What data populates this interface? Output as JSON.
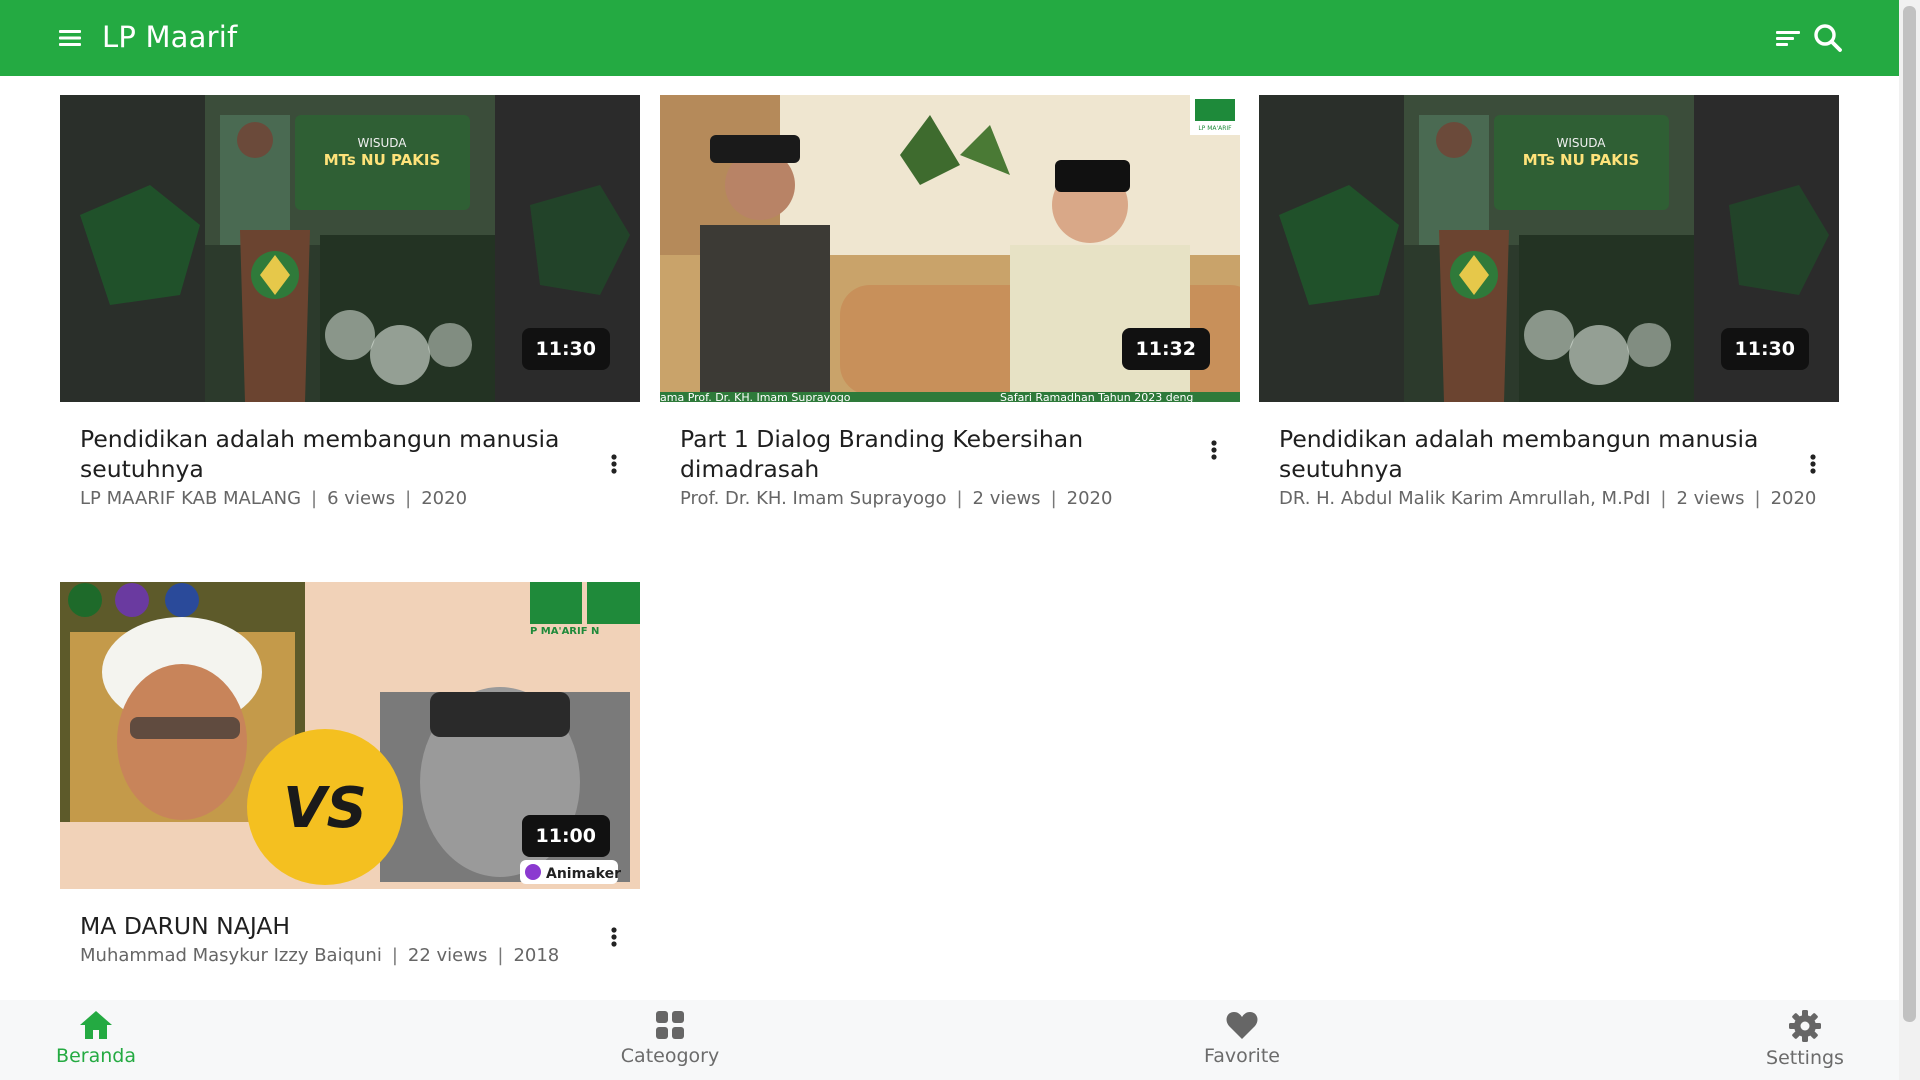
{
  "app": {
    "title": "LP Maarif",
    "accent_color": "#24aa42"
  },
  "videos": [
    {
      "title": "Pendidikan adalah membangun manusia seutuhnya",
      "channel": "LP MAARIF KAB MALANG",
      "views": "6 views",
      "year": "2020",
      "duration": "11:30",
      "thumbnail_text": [
        "WISUDA",
        "MTs NU PAKIS"
      ]
    },
    {
      "title": "Part 1 Dialog Branding Kebersihan dimadrasah",
      "channel": "Prof. Dr. KH. Imam Suprayogo",
      "views": "2 views",
      "year": "2020",
      "duration": "11:32",
      "thumbnail_text": [
        "ama Prof. Dr. KH. Imam Suprayogo",
        "Safari Ramadhan Tahun 2023 deng",
        "LP MA'ARIF"
      ]
    },
    {
      "title": "Pendidikan adalah membangun manusia seutuhnya",
      "channel": "DR. H. Abdul Malik Karim Amrullah, M.PdI",
      "views": "2 views",
      "year": "2020",
      "duration": "11:30",
      "thumbnail_text": [
        "WISUDA",
        "MTs NU PAKIS"
      ]
    },
    {
      "title": "MA DARUN NAJAH",
      "channel": "Muhammad Masykur Izzy Baiquni",
      "views": "22 views",
      "year": "2018",
      "duration": "11:00",
      "thumbnail_text": [
        "VS",
        "Animaker",
        "P MA'ARIF N"
      ]
    }
  ],
  "bottom_nav": [
    {
      "label": "Beranda",
      "icon": "home-icon",
      "active": true
    },
    {
      "label": "Cateogory",
      "icon": "grid-icon",
      "active": false
    },
    {
      "label": "Favorite",
      "icon": "heart-icon",
      "active": false
    },
    {
      "label": "Settings",
      "icon": "gear-icon",
      "active": false
    }
  ]
}
